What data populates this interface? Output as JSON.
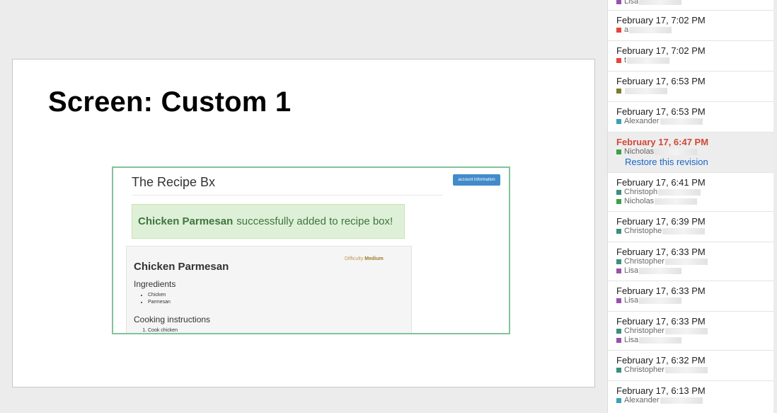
{
  "slide": {
    "title": "Screen: Custom 1",
    "screenshot": {
      "brand": "The Recipe Bx",
      "account_button": "account information",
      "alert_recipe": "Chicken Parmesan",
      "alert_text": "successfully added to recipe box!",
      "difficulty_label": "Difficulty",
      "difficulty_value": "Medium",
      "recipe_name": "Chicken Parmesan",
      "ingredients_heading": "Ingredients",
      "ingredients": [
        "Chicken",
        "Parmesan"
      ],
      "instructions_heading": "Cooking instructions",
      "instructions": [
        "Cook chicken"
      ]
    }
  },
  "revisions": {
    "restore_label": "Restore this revision",
    "items": [
      {
        "date": "",
        "authors": [
          {
            "name": "Lisa",
            "color": "#9c4fb0"
          }
        ]
      },
      {
        "date": "February 17, 7:02 PM",
        "authors": [
          {
            "name": "a",
            "color": "#e8453c"
          }
        ]
      },
      {
        "date": "February 17, 7:02 PM",
        "authors": [
          {
            "name": "t",
            "color": "#e8453c"
          }
        ]
      },
      {
        "date": "February 17, 6:53 PM",
        "authors": [
          {
            "name": "",
            "color": "#7b7d2a"
          }
        ]
      },
      {
        "date": "February 17, 6:53 PM",
        "authors": [
          {
            "name": "Alexander",
            "color": "#3ba0b8"
          }
        ]
      },
      {
        "date": "February 17, 6:47 PM",
        "selected": true,
        "authors": [
          {
            "name": "Nicholas",
            "color": "#3ba047"
          }
        ]
      },
      {
        "date": "February 17, 6:41 PM",
        "authors": [
          {
            "name": "Christoph",
            "color": "#3a8f7d"
          },
          {
            "name": "Nicholas",
            "color": "#3ba047"
          }
        ]
      },
      {
        "date": "February 17, 6:39 PM",
        "authors": [
          {
            "name": "Christophe",
            "color": "#3a8f7d"
          }
        ]
      },
      {
        "date": "February 17, 6:33 PM",
        "authors": [
          {
            "name": "Christopher",
            "color": "#3a8f7d"
          },
          {
            "name": "Lisa",
            "color": "#9c4fb0"
          }
        ]
      },
      {
        "date": "February 17, 6:33 PM",
        "authors": [
          {
            "name": "Lisa",
            "color": "#9c4fb0"
          }
        ]
      },
      {
        "date": "February 17, 6:33 PM",
        "authors": [
          {
            "name": "Christopher",
            "color": "#3a8f7d"
          },
          {
            "name": "Lisa",
            "color": "#9c4fb0"
          }
        ]
      },
      {
        "date": "February 17, 6:32 PM",
        "authors": [
          {
            "name": "Christopher",
            "color": "#3a8f7d"
          }
        ]
      },
      {
        "date": "February 17, 6:13 PM",
        "authors": [
          {
            "name": "Alexander",
            "color": "#3ba0b8"
          }
        ]
      }
    ]
  }
}
